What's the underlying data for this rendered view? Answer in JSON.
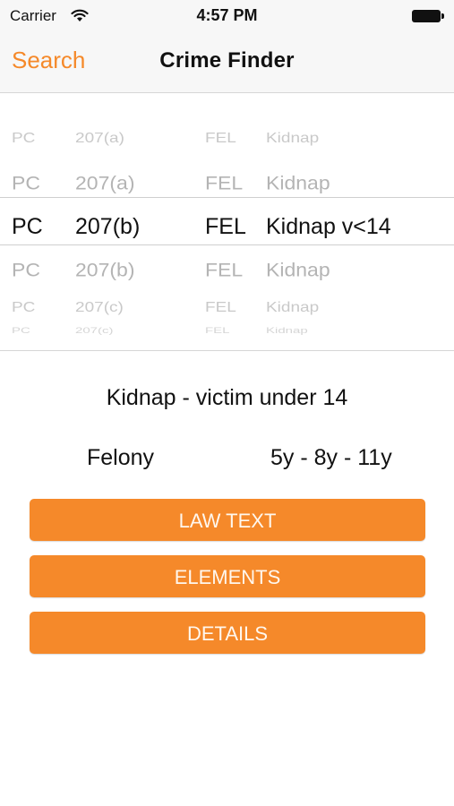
{
  "status_bar": {
    "carrier": "Carrier",
    "time": "4:57 PM",
    "wifi_icon": "wifi-icon",
    "battery_icon": "battery-icon"
  },
  "nav": {
    "back_label": "Search",
    "title": "Crime Finder"
  },
  "picker": {
    "rows": [
      {
        "code": "PC",
        "section": "207(a)",
        "type": "FEL",
        "desc": "Kidnap"
      },
      {
        "code": "PC",
        "section": "207(a)",
        "type": "FEL",
        "desc": "Kidnap"
      },
      {
        "code": "PC",
        "section": "207(b)",
        "type": "FEL",
        "desc": "Kidnap v<14"
      },
      {
        "code": "PC",
        "section": "207(b)",
        "type": "FEL",
        "desc": "Kidnap"
      },
      {
        "code": "PC",
        "section": "207(c)",
        "type": "FEL",
        "desc": "Kidnap"
      },
      {
        "code": "PC",
        "section": "207(c)",
        "type": "FEL",
        "desc": "Kidnap"
      }
    ],
    "selected_index": 2
  },
  "detail": {
    "description": "Kidnap - victim under 14",
    "severity": "Felony",
    "sentence": "5y - 8y - 11y"
  },
  "buttons": {
    "law_text": "LAW TEXT",
    "elements": "ELEMENTS",
    "details": "DETAILS"
  },
  "colors": {
    "accent": "#f5892a",
    "bar_background": "#f7f7f7"
  }
}
